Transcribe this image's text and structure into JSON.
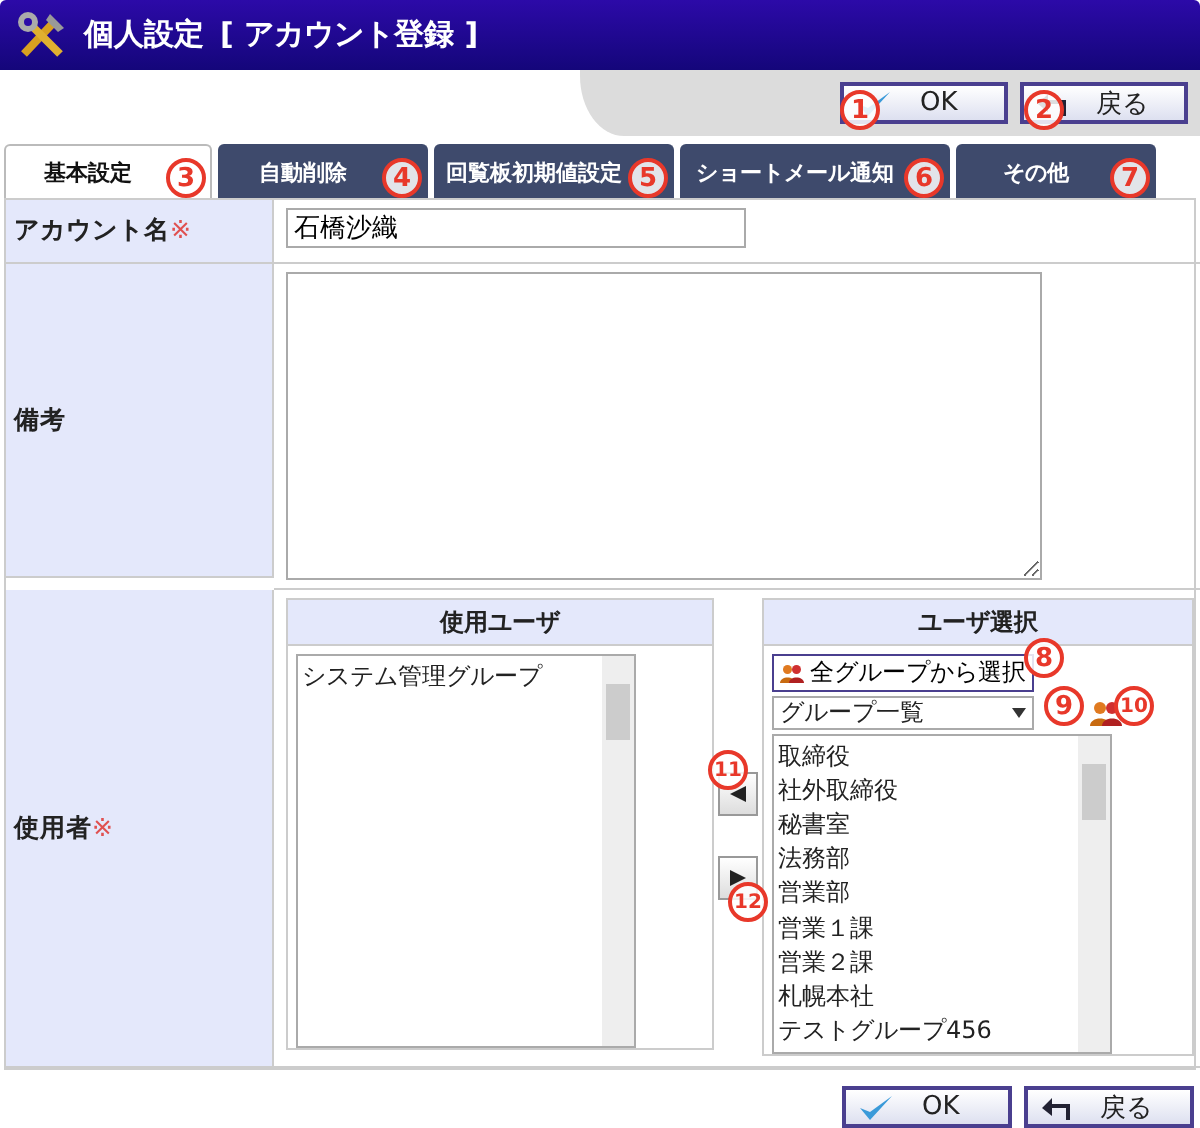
{
  "window": {
    "title": "個人設定",
    "subtitle": "[ アカウント登録 ]"
  },
  "toolbar_buttons": [
    {
      "label": "OK",
      "kind": "ok"
    },
    {
      "label": "戻る",
      "kind": "back"
    }
  ],
  "tabs": [
    {
      "label": "基本設定",
      "selected": true
    },
    {
      "label": "自動削除",
      "selected": false
    },
    {
      "label": "回覧板初期値設定",
      "selected": false
    },
    {
      "label": "ショートメール通知",
      "selected": false
    },
    {
      "label": "その他",
      "selected": false
    }
  ],
  "form": {
    "account_name": {
      "label": "アカウント名",
      "required_mark": "※",
      "value": "石橋沙織"
    },
    "notes": {
      "label": "備考"
    },
    "users": {
      "label": "使用者",
      "required_mark": "※",
      "used_panel": {
        "title": "使用ユーザ",
        "items": [
          "システム管理グループ"
        ]
      },
      "select_panel": {
        "title": "ユーザ選択",
        "select_all_button": "全グループから選択",
        "group_dropdown": "グループ一覧",
        "items": [
          "取締役",
          "社外取締役",
          "秘書室",
          "法務部",
          "営業部",
          "営業１課",
          "営業２課",
          "札幌本社",
          "テストグループ456"
        ]
      }
    }
  },
  "bottom_buttons": [
    {
      "label": "OK",
      "kind": "ok"
    },
    {
      "label": "戻る",
      "kind": "back"
    }
  ],
  "callouts": [
    "1",
    "2",
    "3",
    "4",
    "5",
    "6",
    "7",
    "8",
    "9",
    "10",
    "11",
    "12"
  ]
}
